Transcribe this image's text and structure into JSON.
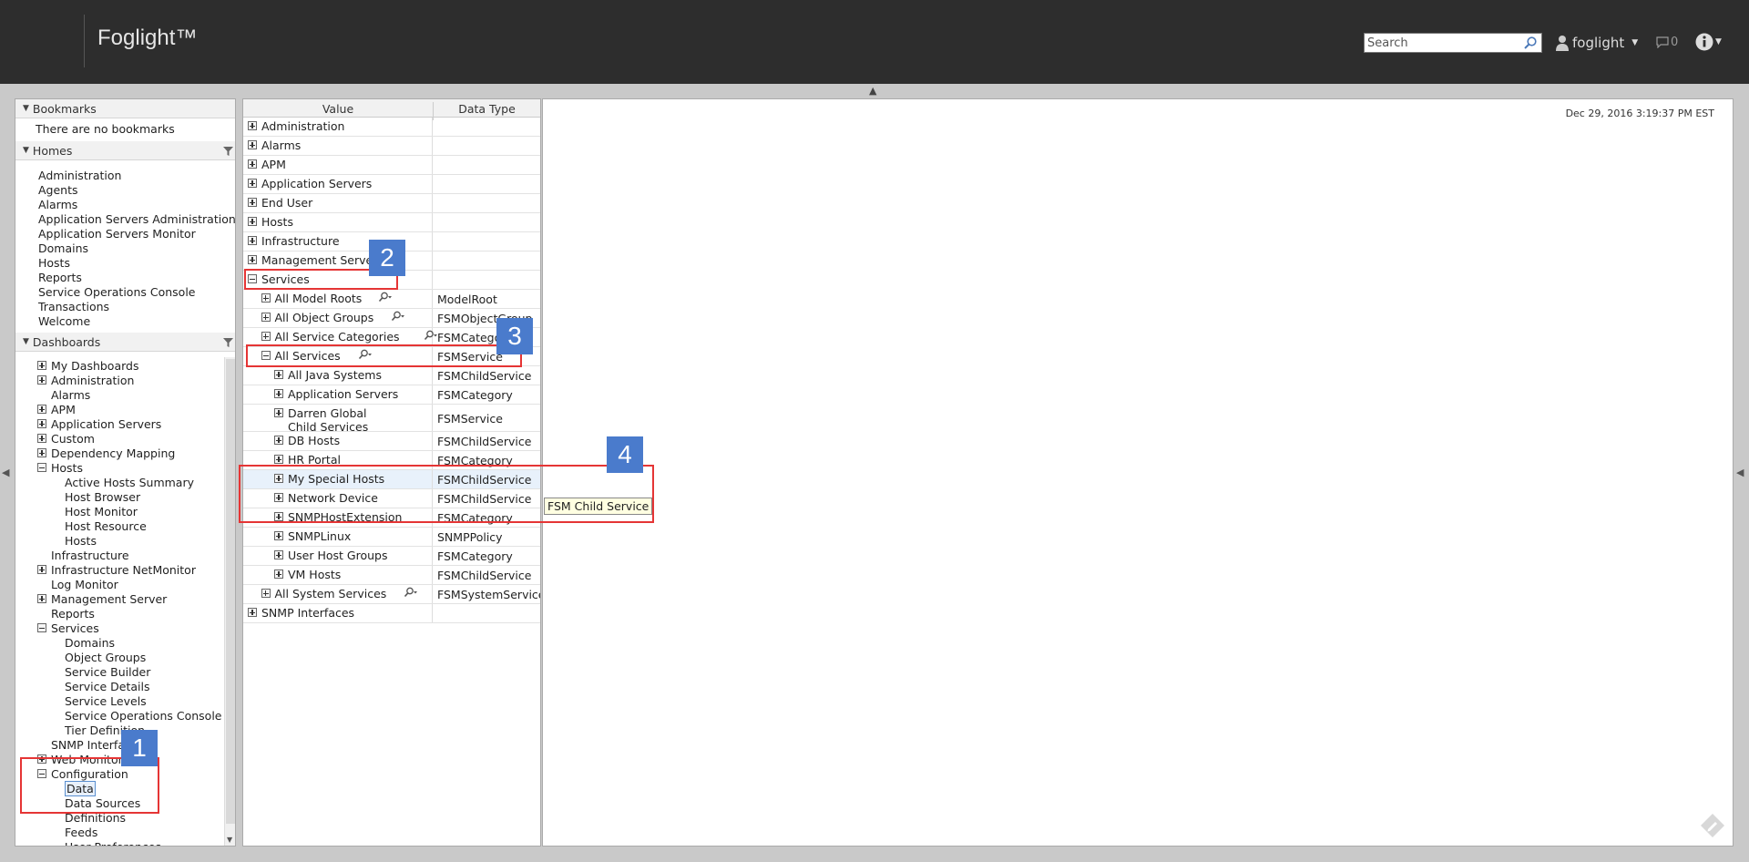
{
  "header": {
    "app_title": "Foglight™",
    "search_placeholder": "Search",
    "username": "foglight",
    "message_count": "0"
  },
  "sidebar": {
    "bookmarks": {
      "title": "Bookmarks",
      "empty_text": "There are no bookmarks"
    },
    "homes": {
      "title": "Homes",
      "items": [
        "Administration",
        "Agents",
        "Alarms",
        "Application Servers Administration",
        "Application Servers Monitor",
        "Domains",
        "Hosts",
        "Reports",
        "Service Operations Console",
        "Transactions",
        "Welcome"
      ]
    },
    "dashboards": {
      "title": "Dashboards",
      "items": [
        {
          "label": "My Dashboards",
          "level": 0,
          "toggle": "plus"
        },
        {
          "label": "Administration",
          "level": 0,
          "toggle": "plus"
        },
        {
          "label": "Alarms",
          "level": 0,
          "toggle": "none"
        },
        {
          "label": "APM",
          "level": 0,
          "toggle": "plus"
        },
        {
          "label": "Application Servers",
          "level": 0,
          "toggle": "plus"
        },
        {
          "label": "Custom",
          "level": 0,
          "toggle": "plus"
        },
        {
          "label": "Dependency Mapping",
          "level": 0,
          "toggle": "plus"
        },
        {
          "label": "Hosts",
          "level": 0,
          "toggle": "minus"
        },
        {
          "label": "Active Hosts Summary",
          "level": 1,
          "toggle": "none"
        },
        {
          "label": "Host Browser",
          "level": 1,
          "toggle": "none"
        },
        {
          "label": "Host Monitor",
          "level": 1,
          "toggle": "none"
        },
        {
          "label": "Host Resource",
          "level": 1,
          "toggle": "none"
        },
        {
          "label": "Hosts",
          "level": 1,
          "toggle": "none"
        },
        {
          "label": "Infrastructure",
          "level": 0,
          "toggle": "none"
        },
        {
          "label": "Infrastructure NetMonitor",
          "level": 0,
          "toggle": "plus"
        },
        {
          "label": "Log Monitor",
          "level": 0,
          "toggle": "none"
        },
        {
          "label": "Management Server",
          "level": 0,
          "toggle": "plus"
        },
        {
          "label": "Reports",
          "level": 0,
          "toggle": "none"
        },
        {
          "label": "Services",
          "level": 0,
          "toggle": "minus"
        },
        {
          "label": "Domains",
          "level": 1,
          "toggle": "none"
        },
        {
          "label": "Object Groups",
          "level": 1,
          "toggle": "none"
        },
        {
          "label": "Service Builder",
          "level": 1,
          "toggle": "none"
        },
        {
          "label": "Service Details",
          "level": 1,
          "toggle": "none"
        },
        {
          "label": "Service Levels",
          "level": 1,
          "toggle": "none"
        },
        {
          "label": "Service Operations Console",
          "level": 1,
          "toggle": "none"
        },
        {
          "label": "Tier Definition",
          "level": 1,
          "toggle": "none"
        },
        {
          "label": "SNMP Interfaces",
          "level": 0,
          "toggle": "none"
        },
        {
          "label": "Web Monitor",
          "level": 0,
          "toggle": "plus"
        },
        {
          "label": "Configuration",
          "level": 0,
          "toggle": "minus"
        },
        {
          "label": "Data",
          "level": 1,
          "toggle": "none",
          "selected": true
        },
        {
          "label": "Data Sources",
          "level": 1,
          "toggle": "none"
        },
        {
          "label": "Definitions",
          "level": 1,
          "toggle": "none"
        },
        {
          "label": "Feeds",
          "level": 1,
          "toggle": "none"
        },
        {
          "label": "User Preferences",
          "level": 1,
          "toggle": "none"
        }
      ]
    }
  },
  "grid": {
    "headers": {
      "value": "Value",
      "data_type": "Data Type"
    },
    "rows": [
      {
        "label": "Administration",
        "type": "",
        "level": 0,
        "toggle": "plus"
      },
      {
        "label": "Alarms",
        "type": "",
        "level": 0,
        "toggle": "plus"
      },
      {
        "label": "APM",
        "type": "",
        "level": 0,
        "toggle": "plus"
      },
      {
        "label": "Application Servers",
        "type": "",
        "level": 0,
        "toggle": "plus"
      },
      {
        "label": "End User",
        "type": "",
        "level": 0,
        "toggle": "plus"
      },
      {
        "label": "Hosts",
        "type": "",
        "level": 0,
        "toggle": "plus"
      },
      {
        "label": "Infrastructure",
        "type": "",
        "level": 0,
        "toggle": "plus"
      },
      {
        "label": "Management Server",
        "type": "",
        "level": 0,
        "toggle": "plus"
      },
      {
        "label": "Services",
        "type": "",
        "level": 0,
        "toggle": "minus"
      },
      {
        "label": "All Model Roots",
        "type": "ModelRoot",
        "level": 1,
        "toggle": "plus",
        "query": true
      },
      {
        "label": "All Object Groups",
        "type": "FSMObjectGroup",
        "level": 1,
        "toggle": "plus",
        "query": true
      },
      {
        "label": "All Service Categories",
        "type": "FSMCategory",
        "level": 1,
        "toggle": "plus",
        "query": true
      },
      {
        "label": "All Services",
        "type": "FSMService",
        "level": 1,
        "toggle": "minus",
        "query": true
      },
      {
        "label": "All Java Systems",
        "type": "FSMChildService",
        "level": 2,
        "toggle": "plus"
      },
      {
        "label": "Application Servers",
        "type": "FSMCategory",
        "level": 2,
        "toggle": "plus"
      },
      {
        "label": "Darren Global Child Services",
        "type": "FSMService",
        "level": 2,
        "toggle": "plus",
        "tall": true
      },
      {
        "label": "DB Hosts",
        "type": "FSMChildService",
        "level": 2,
        "toggle": "plus"
      },
      {
        "label": "HR Portal",
        "type": "FSMCategory",
        "level": 2,
        "toggle": "plus"
      },
      {
        "label": "My Special Hosts",
        "type": "FSMChildService",
        "level": 2,
        "toggle": "plus",
        "highlight": true
      },
      {
        "label": "Network Device",
        "type": "FSMChildService",
        "level": 2,
        "toggle": "plus"
      },
      {
        "label": "SNMPHostExtension",
        "type": "FSMCategory",
        "level": 2,
        "toggle": "plus"
      },
      {
        "label": "SNMPLinux",
        "type": "SNMPPolicy",
        "level": 2,
        "toggle": "plus"
      },
      {
        "label": "User Host Groups",
        "type": "FSMCategory",
        "level": 2,
        "toggle": "plus"
      },
      {
        "label": "VM Hosts",
        "type": "FSMChildService",
        "level": 2,
        "toggle": "plus"
      },
      {
        "label": "All System Services",
        "type": "FSMSystemService",
        "level": 1,
        "toggle": "plus",
        "query": true
      },
      {
        "label": "SNMP Interfaces",
        "type": "",
        "level": 0,
        "toggle": "plus"
      }
    ]
  },
  "main": {
    "timestamp": "Dec 29, 2016 3:19:37 PM EST"
  },
  "tooltip": "FSM Child Service",
  "annotations": [
    "1",
    "2",
    "3",
    "4"
  ],
  "colors": {
    "topbar": "#2d2d2d",
    "annotation_box": "#e53535",
    "annotation_badge": "#4a7bcc",
    "tooltip_bg": "#ffffe1"
  }
}
